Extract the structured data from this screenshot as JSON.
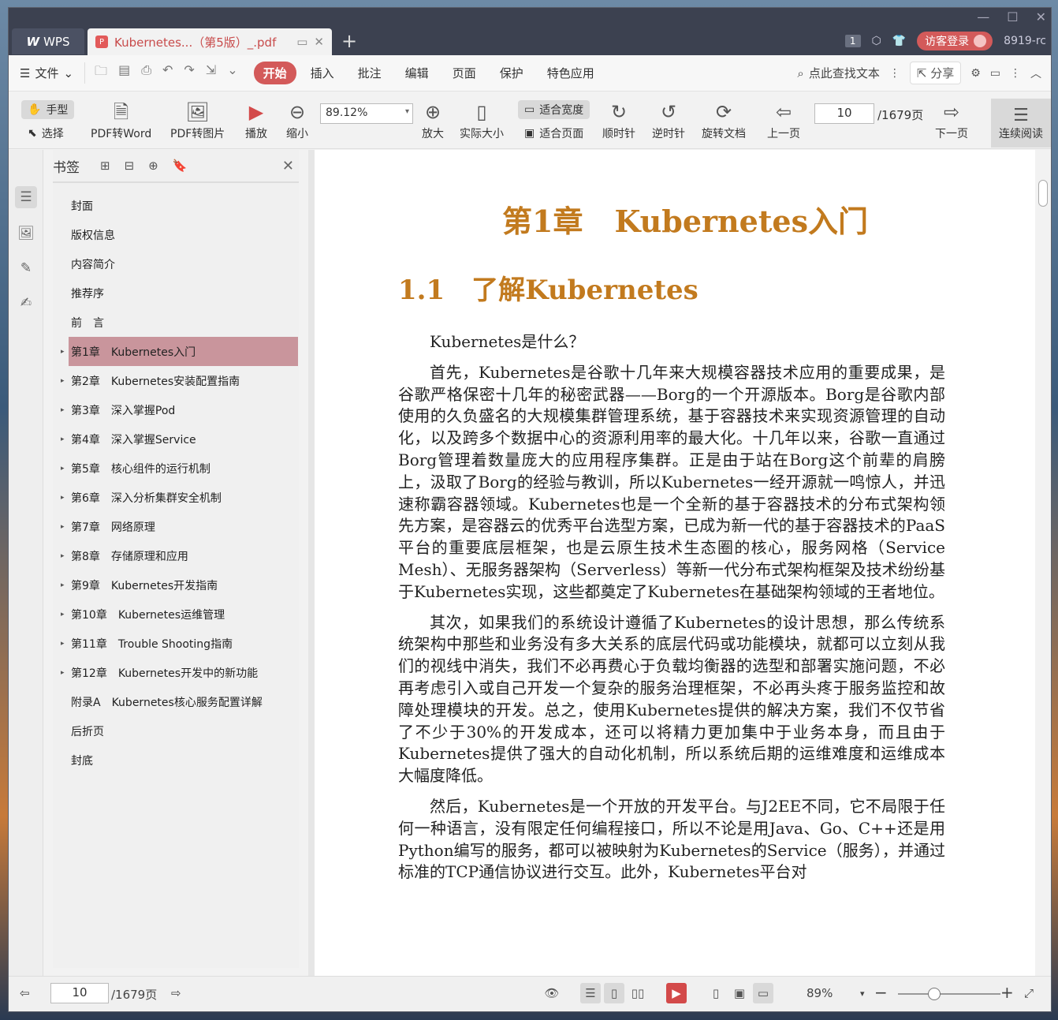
{
  "titlebar": {
    "wps_label": "WPS",
    "doc_tab_title": "Kubernetes...（第5版）_.pdf",
    "new_tab": "+",
    "page_badge": "1",
    "login": "访客登录",
    "user_id": "8919-rc"
  },
  "menubar": {
    "file": "文件",
    "tabs": [
      {
        "label": "开始",
        "active": true
      },
      {
        "label": "插入"
      },
      {
        "label": "批注"
      },
      {
        "label": "编辑"
      },
      {
        "label": "页面"
      },
      {
        "label": "保护"
      },
      {
        "label": "特色应用"
      }
    ],
    "search_placeholder": "点此查找文本",
    "share": "分享"
  },
  "toolbar": {
    "hand": "手型",
    "select": "选择",
    "pdf_to_word": "PDF转Word",
    "pdf_to_image": "PDF转图片",
    "play": "播放",
    "zoom_out": "缩小",
    "zoom_value": "89.12%",
    "zoom_in": "放大",
    "actual_size": "实际大小",
    "fit_width": "适合宽度",
    "fit_page": "适合页面",
    "rotate_cw": "顺时针",
    "rotate_ccw": "逆时针",
    "rotate_doc": "旋转文档",
    "prev_page": "上一页",
    "current_page": "10",
    "total_pages": "/1679页",
    "next_page": "下一页",
    "continuous": "连续阅读"
  },
  "bookmarks": {
    "title": "书签",
    "items": [
      {
        "label": "封面",
        "expandable": false
      },
      {
        "label": "版权信息",
        "expandable": false
      },
      {
        "label": "内容简介",
        "expandable": false
      },
      {
        "label": "推荐序",
        "expandable": false
      },
      {
        "label": "前　言",
        "expandable": false
      },
      {
        "label": "第1章　Kubernetes入门",
        "expandable": true,
        "selected": true
      },
      {
        "label": "第2章　Kubernetes安装配置指南",
        "expandable": true
      },
      {
        "label": "第3章　深入掌握Pod",
        "expandable": true
      },
      {
        "label": "第4章　深入掌握Service",
        "expandable": true
      },
      {
        "label": "第5章　核心组件的运行机制",
        "expandable": true
      },
      {
        "label": "第6章　深入分析集群安全机制",
        "expandable": true
      },
      {
        "label": "第7章　网络原理",
        "expandable": true
      },
      {
        "label": "第8章　存储原理和应用",
        "expandable": true
      },
      {
        "label": "第9章　Kubernetes开发指南",
        "expandable": true
      },
      {
        "label": "第10章　Kubernetes运维管理",
        "expandable": true
      },
      {
        "label": "第11章　Trouble Shooting指南",
        "expandable": true
      },
      {
        "label": "第12章　Kubernetes开发中的新功能",
        "expandable": true
      },
      {
        "label": "附录A　Kubernetes核心服务配置详解",
        "expandable": false
      },
      {
        "label": "后折页",
        "expandable": false
      },
      {
        "label": "封底",
        "expandable": false
      }
    ]
  },
  "document": {
    "chapter_title_num": "第1章",
    "chapter_title_text": "Kubernetes入门",
    "section_num": "1.1",
    "section_title": "了解Kubernetes",
    "paragraphs": [
      "Kubernetes是什么？",
      "首先，Kubernetes是谷歌十几年来大规模容器技术应用的重要成果，是谷歌严格保密十几年的秘密武器——Borg的一个开源版本。Borg是谷歌内部使用的久负盛名的大规模集群管理系统，基于容器技术来实现资源管理的自动化，以及跨多个数据中心的资源利用率的最大化。十几年以来，谷歌一直通过Borg管理着数量庞大的应用程序集群。正是由于站在Borg这个前辈的肩膀上，汲取了Borg的经验与教训，所以Kubernetes一经开源就一鸣惊人，并迅速称霸容器领域。Kubernetes也是一个全新的基于容器技术的分布式架构领先方案，是容器云的优秀平台选型方案，已成为新一代的基于容器技术的PaaS平台的重要底层框架，也是云原生技术生态圈的核心，服务网格（Service Mesh）、无服务器架构（Serverless）等新一代分布式架构框架及技术纷纷基于Kubernetes实现，这些都奠定了Kubernetes在基础架构领域的王者地位。",
      "其次，如果我们的系统设计遵循了Kubernetes的设计思想，那么传统系统架构中那些和业务没有多大关系的底层代码或功能模块，就都可以立刻从我们的视线中消失，我们不必再费心于负载均衡器的选型和部署实施问题，不必再考虑引入或自己开发一个复杂的服务治理框架，不必再头疼于服务监控和故障处理模块的开发。总之，使用Kubernetes提供的解决方案，我们不仅节省了不少于30%的开发成本，还可以将精力更加集中于业务本身，而且由于Kubernetes提供了强大的自动化机制，所以系统后期的运维难度和运维成本大幅度降低。",
      "然后，Kubernetes是一个开放的开发平台。与J2EE不同，它不局限于任何一种语言，没有限定任何编程接口，所以不论是用Java、Go、C++还是用Python编写的服务，都可以被映射为Kubernetes的Service（服务），并通过标准的TCP通信协议进行交互。此外，Kubernetes平台对"
    ]
  },
  "statusbar": {
    "current_page": "10",
    "total_pages": "/1679页",
    "zoom": "89%",
    "zoom_slider_fraction": 0.35
  }
}
